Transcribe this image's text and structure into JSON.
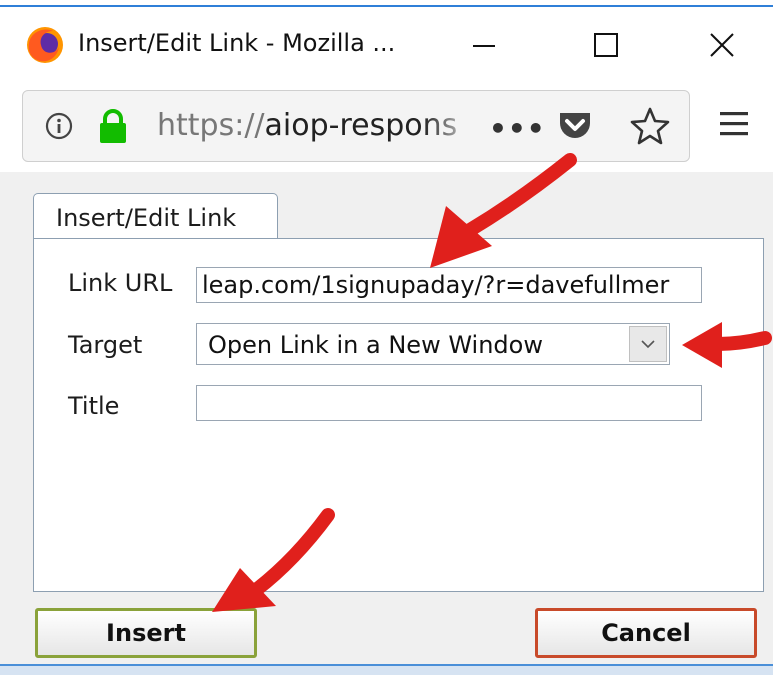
{
  "window": {
    "title": "Insert/Edit Link - Mozilla ...",
    "icons": {
      "app": "firefox-icon",
      "minimize": "minimize-icon",
      "maximize": "maximize-icon",
      "close": "close-icon"
    }
  },
  "urlbar": {
    "scheme": "https://",
    "host": "aiop-respons",
    "icons": [
      "info-icon",
      "lock-icon",
      "more-icon",
      "pocket-icon",
      "star-icon",
      "menu-icon"
    ],
    "more_glyph": "•••"
  },
  "dialog": {
    "tab_label": "Insert/Edit Link",
    "fields": {
      "link_url_label": "Link URL",
      "link_url_value": "leap.com/1signupaday/?r=davefullmer",
      "target_label": "Target",
      "target_value": "Open Link in a New Window",
      "title_label": "Title",
      "title_value": ""
    },
    "buttons": {
      "insert": "Insert",
      "cancel": "Cancel"
    }
  },
  "colors": {
    "arrow": "#e0201c",
    "insert_border": "#8aa23a",
    "cancel_border": "#c84a2a",
    "lock_green": "#12bc00"
  }
}
